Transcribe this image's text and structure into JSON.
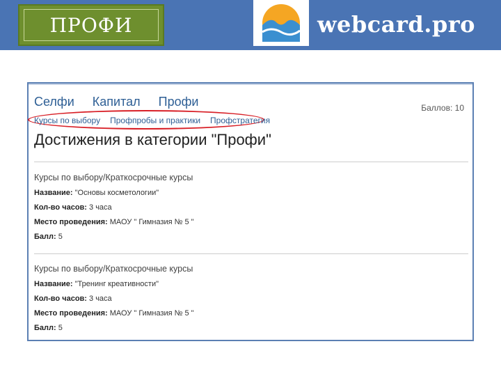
{
  "banner": {
    "badge_title": "ПРОФИ",
    "brand_text": "webcard.pro",
    "colors": {
      "bar": "#4a74b4",
      "badge": "#6e8f2e",
      "logo_orange": "#f5a623",
      "logo_blue": "#3b8fd0"
    }
  },
  "page": {
    "nav": [
      "Селфи",
      "Капитал",
      "Профи"
    ],
    "score": "Баллов: 10",
    "subnav": [
      "Курсы по выбору",
      "Профпробы и практики",
      "Профстратегия"
    ],
    "heading": "Достижения в категории \"Профи\"",
    "entries": [
      {
        "category": "Курсы по выбору/Краткосрочные курсы",
        "name_label": "Название:",
        "name_value": "\"Основы косметологии\"",
        "hours_label": "Кол-во часов:",
        "hours_value": "3 часа",
        "place_label": "Место проведения:",
        "place_value": "МАОУ \" Гимназия № 5 \"",
        "points_label": "Балл:",
        "points_value": "5"
      },
      {
        "category": "Курсы по выбору/Краткосрочные курсы",
        "name_label": "Название:",
        "name_value": "\"Тренинг креативности\"",
        "hours_label": "Кол-во часов:",
        "hours_value": "3 часа",
        "place_label": "Место проведения:",
        "place_value": "МАОУ \" Гимназия № 5 \"",
        "points_label": "Балл:",
        "points_value": "5"
      }
    ]
  }
}
